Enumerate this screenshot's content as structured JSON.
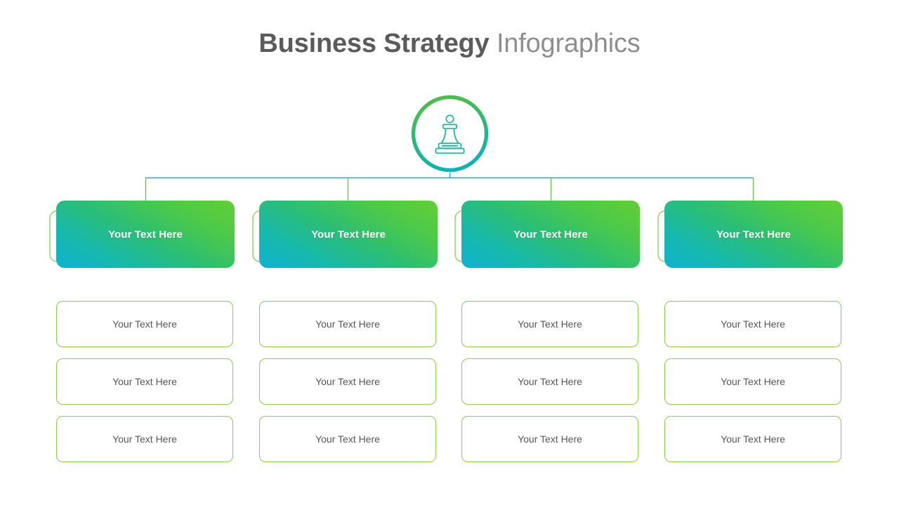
{
  "title": {
    "bold_part": "Business Strategy",
    "light_part": "Infographics"
  },
  "hub": {
    "icon": "chess-pawn-icon",
    "ring_color_top": "#47b84f",
    "ring_color_bottom": "#16b3a8",
    "icon_stroke": "#1bb39c"
  },
  "connectors": {
    "horizontal_color": "#19aec8",
    "vertical_color": "#6cc644"
  },
  "theme": {
    "gradient_start": "#0eb3d0",
    "gradient_end": "#63ce36",
    "outline_green": "#8ccd4e",
    "title_bold_color": "#5b5b5b",
    "title_light_color": "#8e8e8e",
    "sub_text_color": "#565656"
  },
  "columns": [
    {
      "header": "Your Text Here",
      "items": [
        "Your Text Here",
        "Your Text Here",
        "Your Text Here"
      ]
    },
    {
      "header": "Your Text Here",
      "items": [
        "Your Text Here",
        "Your Text Here",
        "Your Text Here"
      ]
    },
    {
      "header": "Your Text Here",
      "items": [
        "Your Text Here",
        "Your Text Here",
        "Your Text Here"
      ]
    },
    {
      "header": "Your Text Here",
      "items": [
        "Your Text Here",
        "Your Text Here",
        "Your Text Here"
      ]
    }
  ]
}
